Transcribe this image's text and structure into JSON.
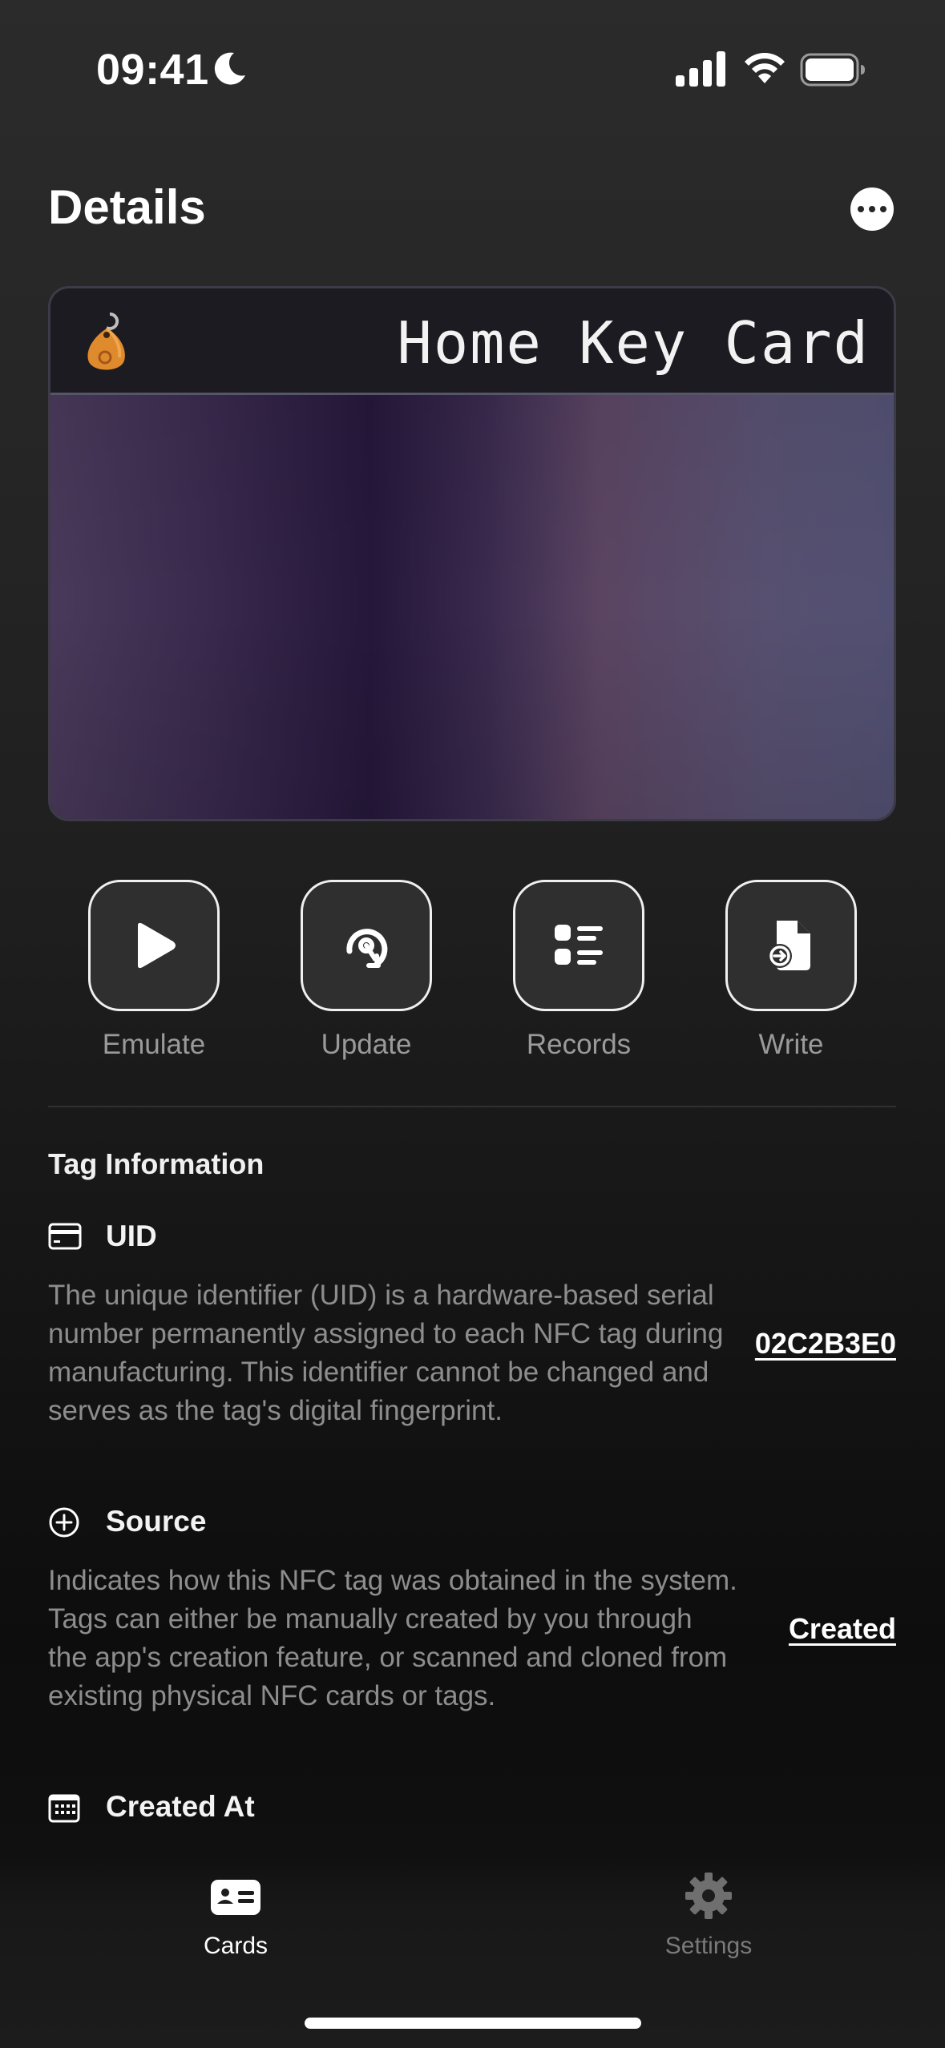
{
  "status_bar": {
    "time": "09:41"
  },
  "header": {
    "title": "Details"
  },
  "card": {
    "title": "Home Key Card"
  },
  "actions": [
    {
      "label": "Emulate",
      "icon": "play-icon"
    },
    {
      "label": "Update",
      "icon": "update-icon"
    },
    {
      "label": "Records",
      "icon": "list-icon"
    },
    {
      "label": "Write",
      "icon": "write-document-icon"
    }
  ],
  "tag_info": {
    "section_title": "Tag Information",
    "uid": {
      "title": "UID",
      "description": "The unique identifier (UID) is a hardware-based serial number permanently assigned to each NFC tag during manufacturing. This identifier cannot be changed and serves as the tag's digital fingerprint.",
      "value": "02C2B3E0"
    },
    "source": {
      "title": "Source",
      "description": "Indicates how this NFC tag was obtained in the system. Tags can either be manually created by you through the app's creation feature, or scanned and cloned from existing physical NFC cards or tags.",
      "value": "Created"
    },
    "created_at": {
      "title": "Created At"
    }
  },
  "tab_bar": {
    "tabs": [
      {
        "label": "Cards",
        "active": true
      },
      {
        "label": "Settings",
        "active": false
      }
    ]
  }
}
